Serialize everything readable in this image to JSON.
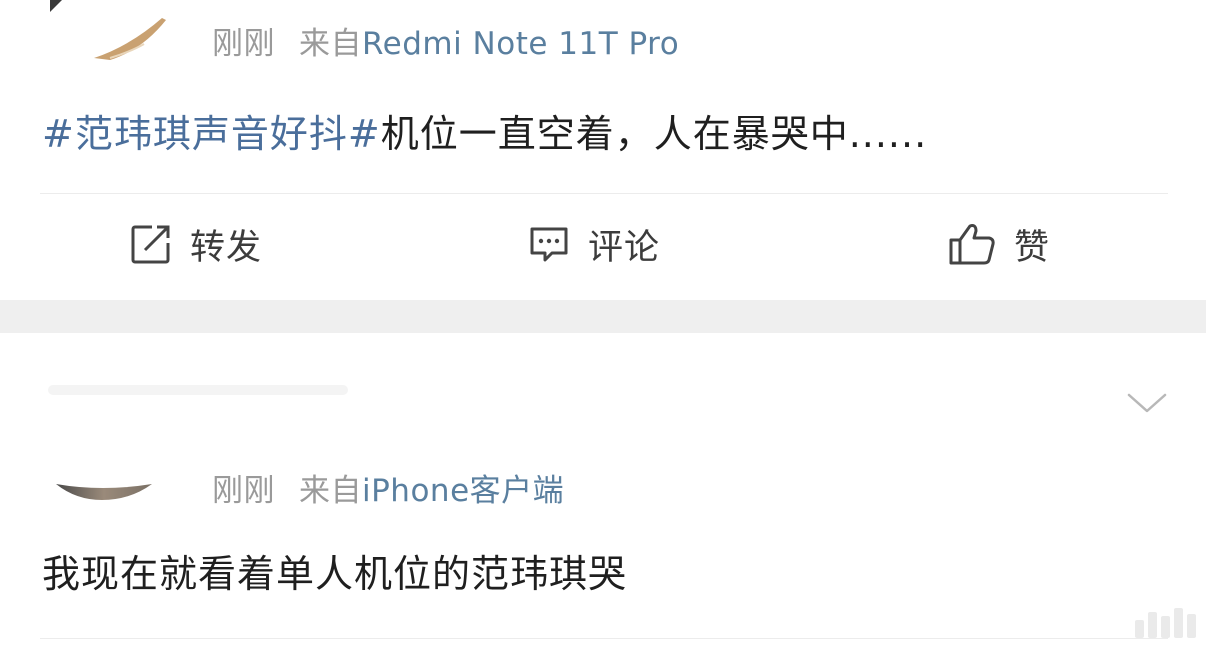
{
  "post1": {
    "time": "刚刚",
    "from_prefix": "来自",
    "source": "Redmi Note 11T Pro",
    "topic": "#范玮琪声音好抖#",
    "text": "机位一直空着，人在暴哭中......"
  },
  "actions": {
    "repost": {
      "label": "转发",
      "icon": "share-icon"
    },
    "comment": {
      "label": "评论",
      "icon": "comment-icon"
    },
    "like": {
      "label": "赞",
      "icon": "thumbs-up-icon"
    }
  },
  "post2": {
    "time": "刚刚",
    "from_prefix": "来自",
    "source": "iPhone客户端",
    "text": "我现在就看着单人机位的范玮琪哭",
    "menu_icon": "chevron-down-icon"
  },
  "colors": {
    "topic": "#4a6e9b",
    "source": "#5a7f9f",
    "meta": "#9a9a9a",
    "separator": "#efefef"
  }
}
